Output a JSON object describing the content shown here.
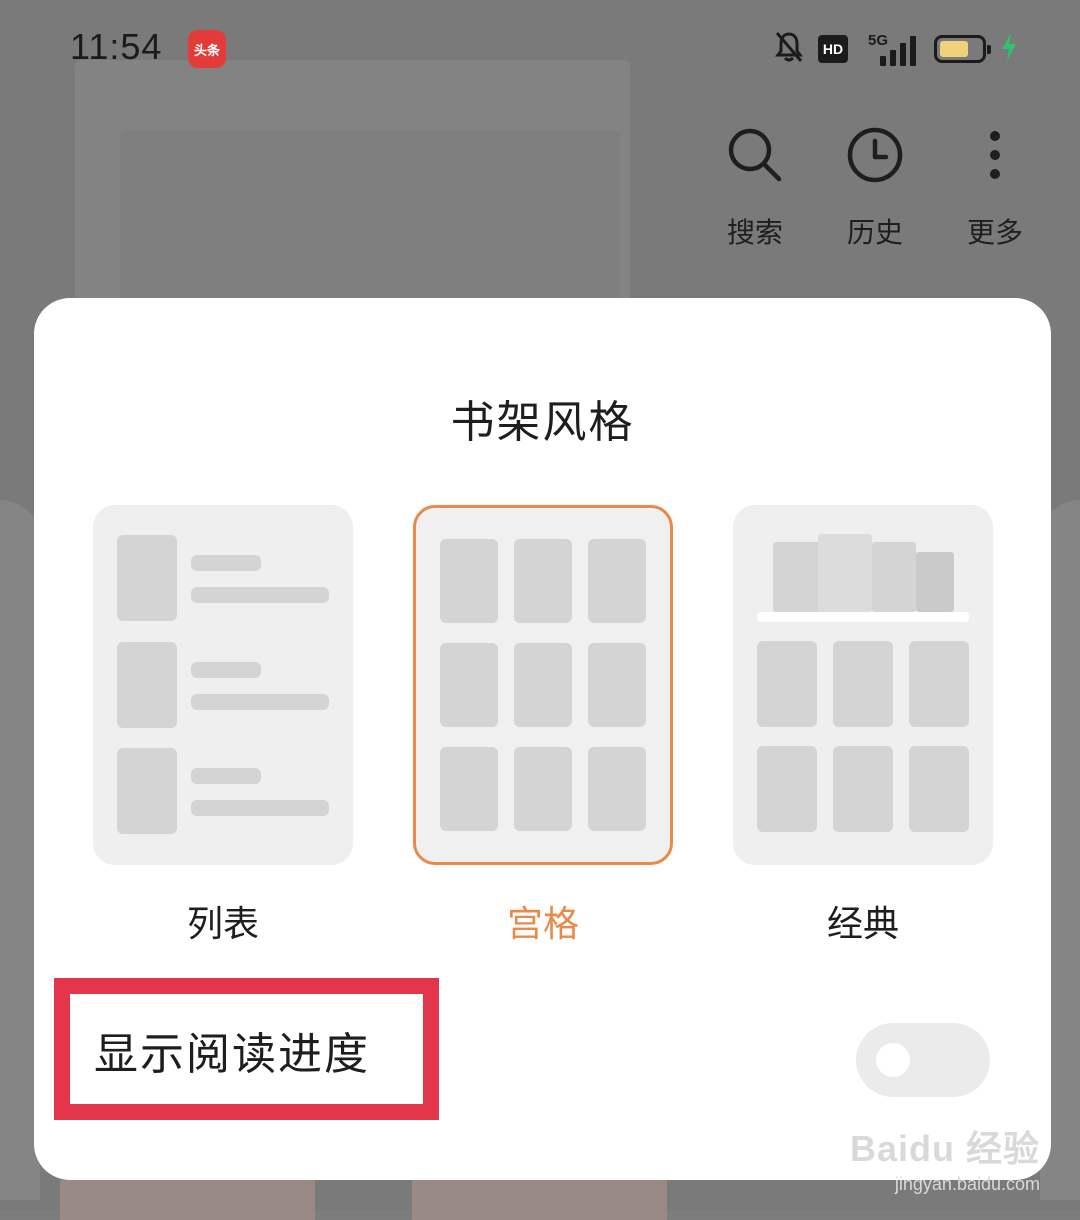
{
  "status_bar": {
    "time": "11:54",
    "app_badge": "头条",
    "hd": "HD",
    "network": "5G"
  },
  "top_actions": [
    {
      "label": "搜索",
      "icon": "search-icon"
    },
    {
      "label": "历史",
      "icon": "clock-icon"
    },
    {
      "label": "更多",
      "icon": "more-vertical-icon"
    }
  ],
  "dialog": {
    "title": "书架风格",
    "options": [
      {
        "label": "列表",
        "selected": false
      },
      {
        "label": "宫格",
        "selected": true
      },
      {
        "label": "经典",
        "selected": false
      }
    ],
    "progress_label": "显示阅读进度",
    "progress_toggle_on": false
  },
  "watermark": {
    "main": "Baidu 经验",
    "sub": "jingyan.baidu.com"
  },
  "colors": {
    "accent": "#ea8a4a",
    "highlight": "#e3364a",
    "battery": "#efd27a",
    "charging": "#2fc46a"
  }
}
